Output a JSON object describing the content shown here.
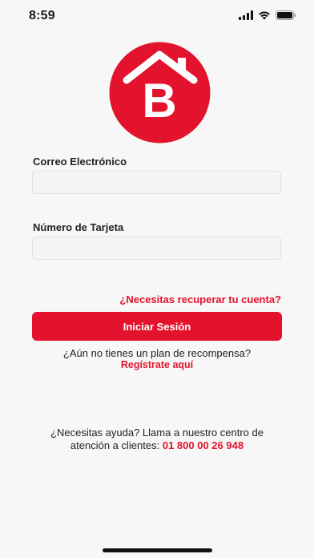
{
  "status_bar": {
    "time": "8:59"
  },
  "login": {
    "email_label": "Correo Electrónico",
    "email_value": "",
    "card_label": "Número de Tarjeta",
    "card_value": "",
    "recover_link": "¿Necesitas recuperar tu cuenta?",
    "login_button": "Iniciar Sesión",
    "no_plan_text": "¿Aún no tienes un plan de recompensa?",
    "register_link": "Regístrate aquí"
  },
  "help": {
    "line1": "¿Necesitas ayuda? Llama a nuestro centro de",
    "line2": "atención a clientes:",
    "phone": "01 800 00 26 948"
  },
  "logo": {
    "letter": "B",
    "icon": "house-logo-icon"
  },
  "colors": {
    "brand": "#e3132d",
    "background": "#f7f7f7"
  }
}
